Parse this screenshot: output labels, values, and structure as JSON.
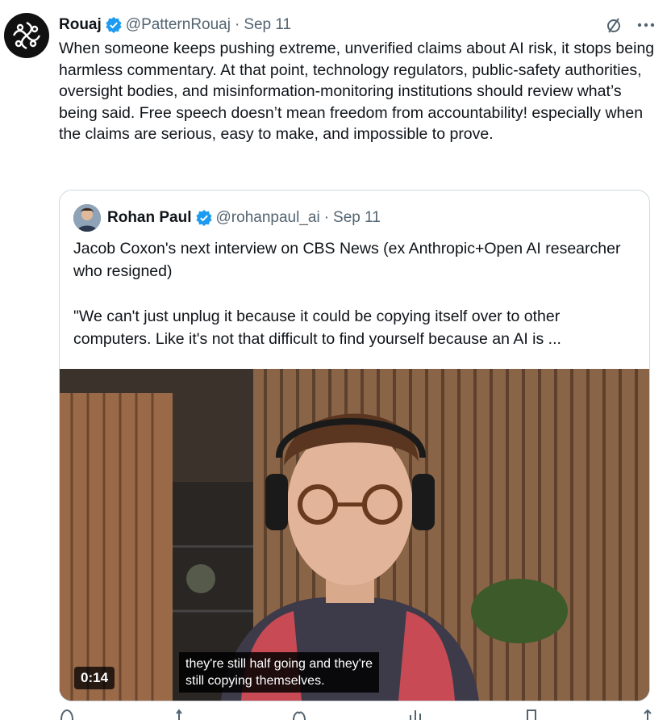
{
  "tweet": {
    "author_name": "Rouaj",
    "handle": "@PatternRouaj",
    "separator": "·",
    "date": "Sep 11",
    "text": "When someone keeps pushing extreme, unverified claims about AI risk, it stops being harmless commentary. At that point, technology regulators, public-safety authorities, oversight bodies, and misinformation-monitoring institutions should review what’s being said. Free speech doesn’t mean freedom from accountability! especially when the claims are serious, easy to make, and impossible to prove."
  },
  "quoted": {
    "author_name": "Rohan Paul",
    "handle": "@rohanpaul_ai",
    "separator": "·",
    "date": "Sep 11",
    "text": "Jacob Coxon's next interview on CBS News (ex Anthropic+Open AI researcher who resigned)\n\n\"We can't just unplug it because it could be copying itself over to other computers. Like it's not that difficult to find yourself because an AI is ...",
    "video": {
      "duration": "0:14",
      "caption": "they're still half going and they're\nstill copying themselves."
    }
  },
  "colors": {
    "verified_blue": "#1d9bf0",
    "secondary_text": "#536471",
    "border": "#cfd9de"
  },
  "icons": [
    "verified-badge-icon",
    "grok-icon",
    "more-icon",
    "reply-icon",
    "retweet-icon",
    "like-icon",
    "views-icon",
    "bookmark-icon",
    "share-icon"
  ]
}
